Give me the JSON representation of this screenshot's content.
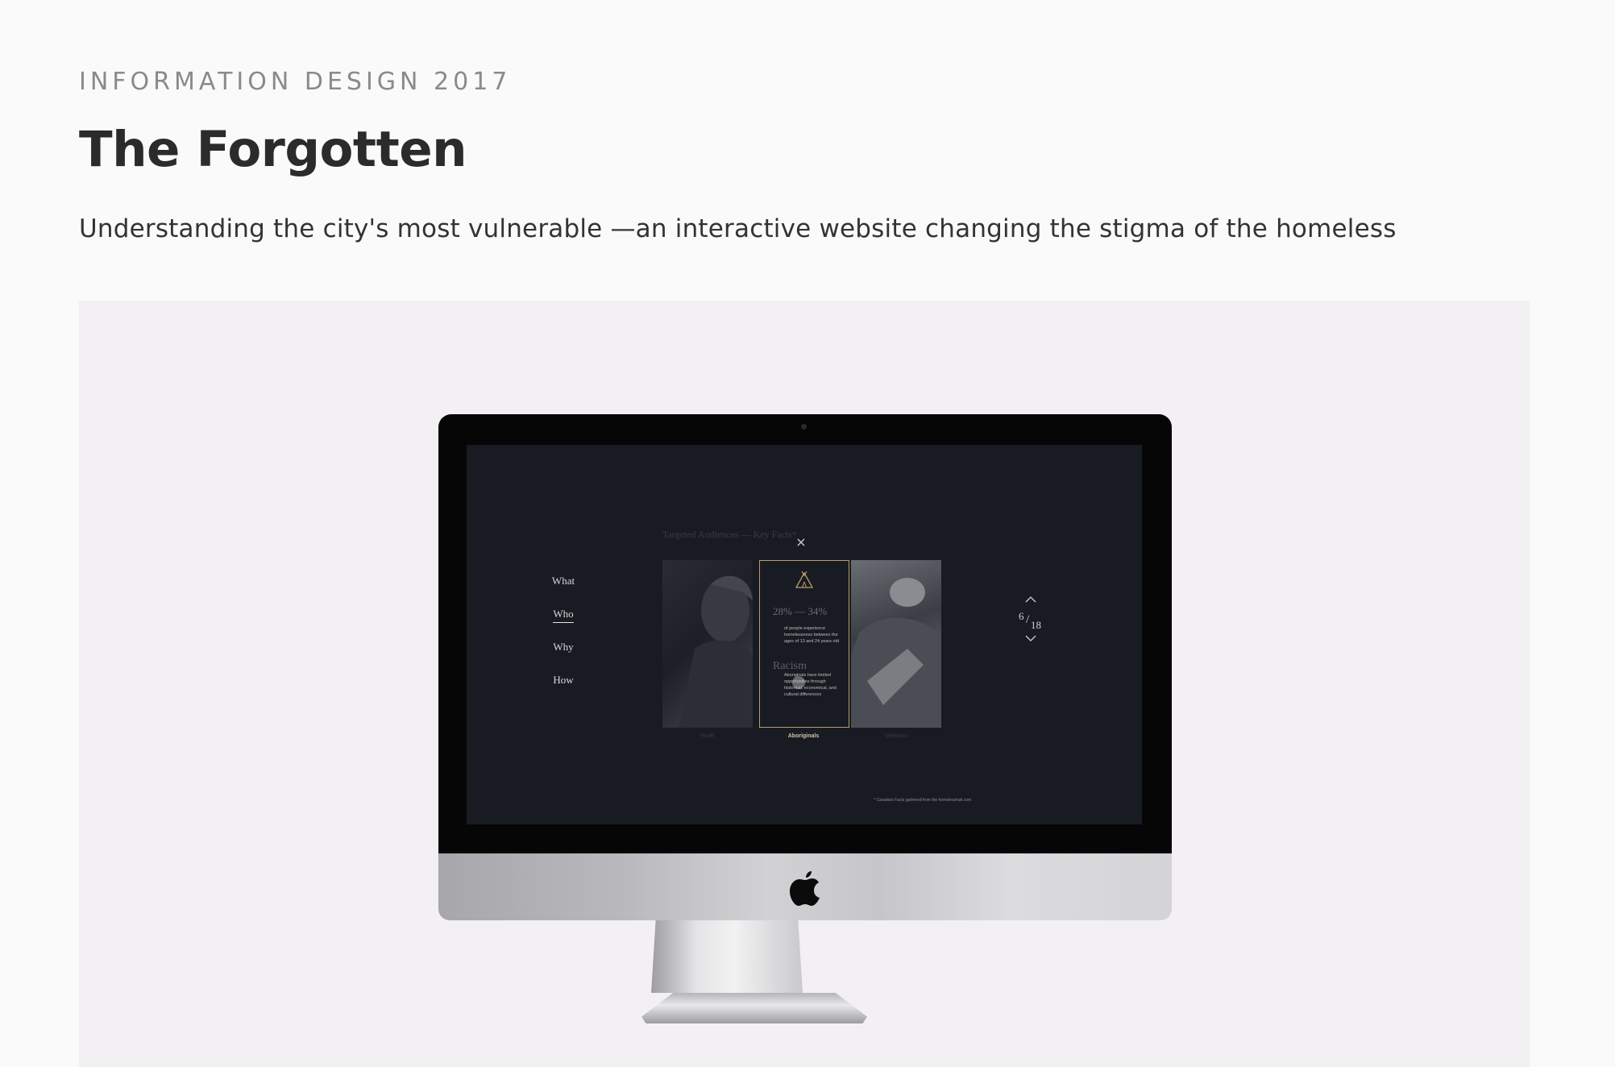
{
  "header": {
    "eyebrow": "INFORMATION DESIGN 2017",
    "title": "The Forgotten",
    "subtitle": "Understanding the city's most vulnerable —an interactive website changing the stigma of the homeless"
  },
  "mockup": {
    "heading": "Targeted Audiences — Key Facts*",
    "close_label": "×",
    "nav": {
      "items": [
        {
          "label": "What"
        },
        {
          "label": "Who"
        },
        {
          "label": "Why"
        },
        {
          "label": "How"
        }
      ],
      "active": "Who"
    },
    "cards": {
      "left_label": "Youth",
      "center_label": "Aboriginals",
      "right_label": "Veterans"
    },
    "center_card": {
      "stat1_big": "28% — 34%",
      "stat1_text": "of people experience homelessness between the ages of 13 and 24 years old",
      "stat2_big": "Racism",
      "stat2_text": "Aboriginals have limited opportunities through historical, economical, and cultural differences"
    },
    "pager": {
      "current": "6",
      "slash": "/",
      "total": "18"
    },
    "footnote": "* Canadian Facts gathered from the homelesshub.com"
  },
  "colors": {
    "page_bg": "#fafafa",
    "showcase_bg": "#f2f0f2",
    "screen_bg": "#191b22",
    "accent_gold": "#b59c6d"
  }
}
